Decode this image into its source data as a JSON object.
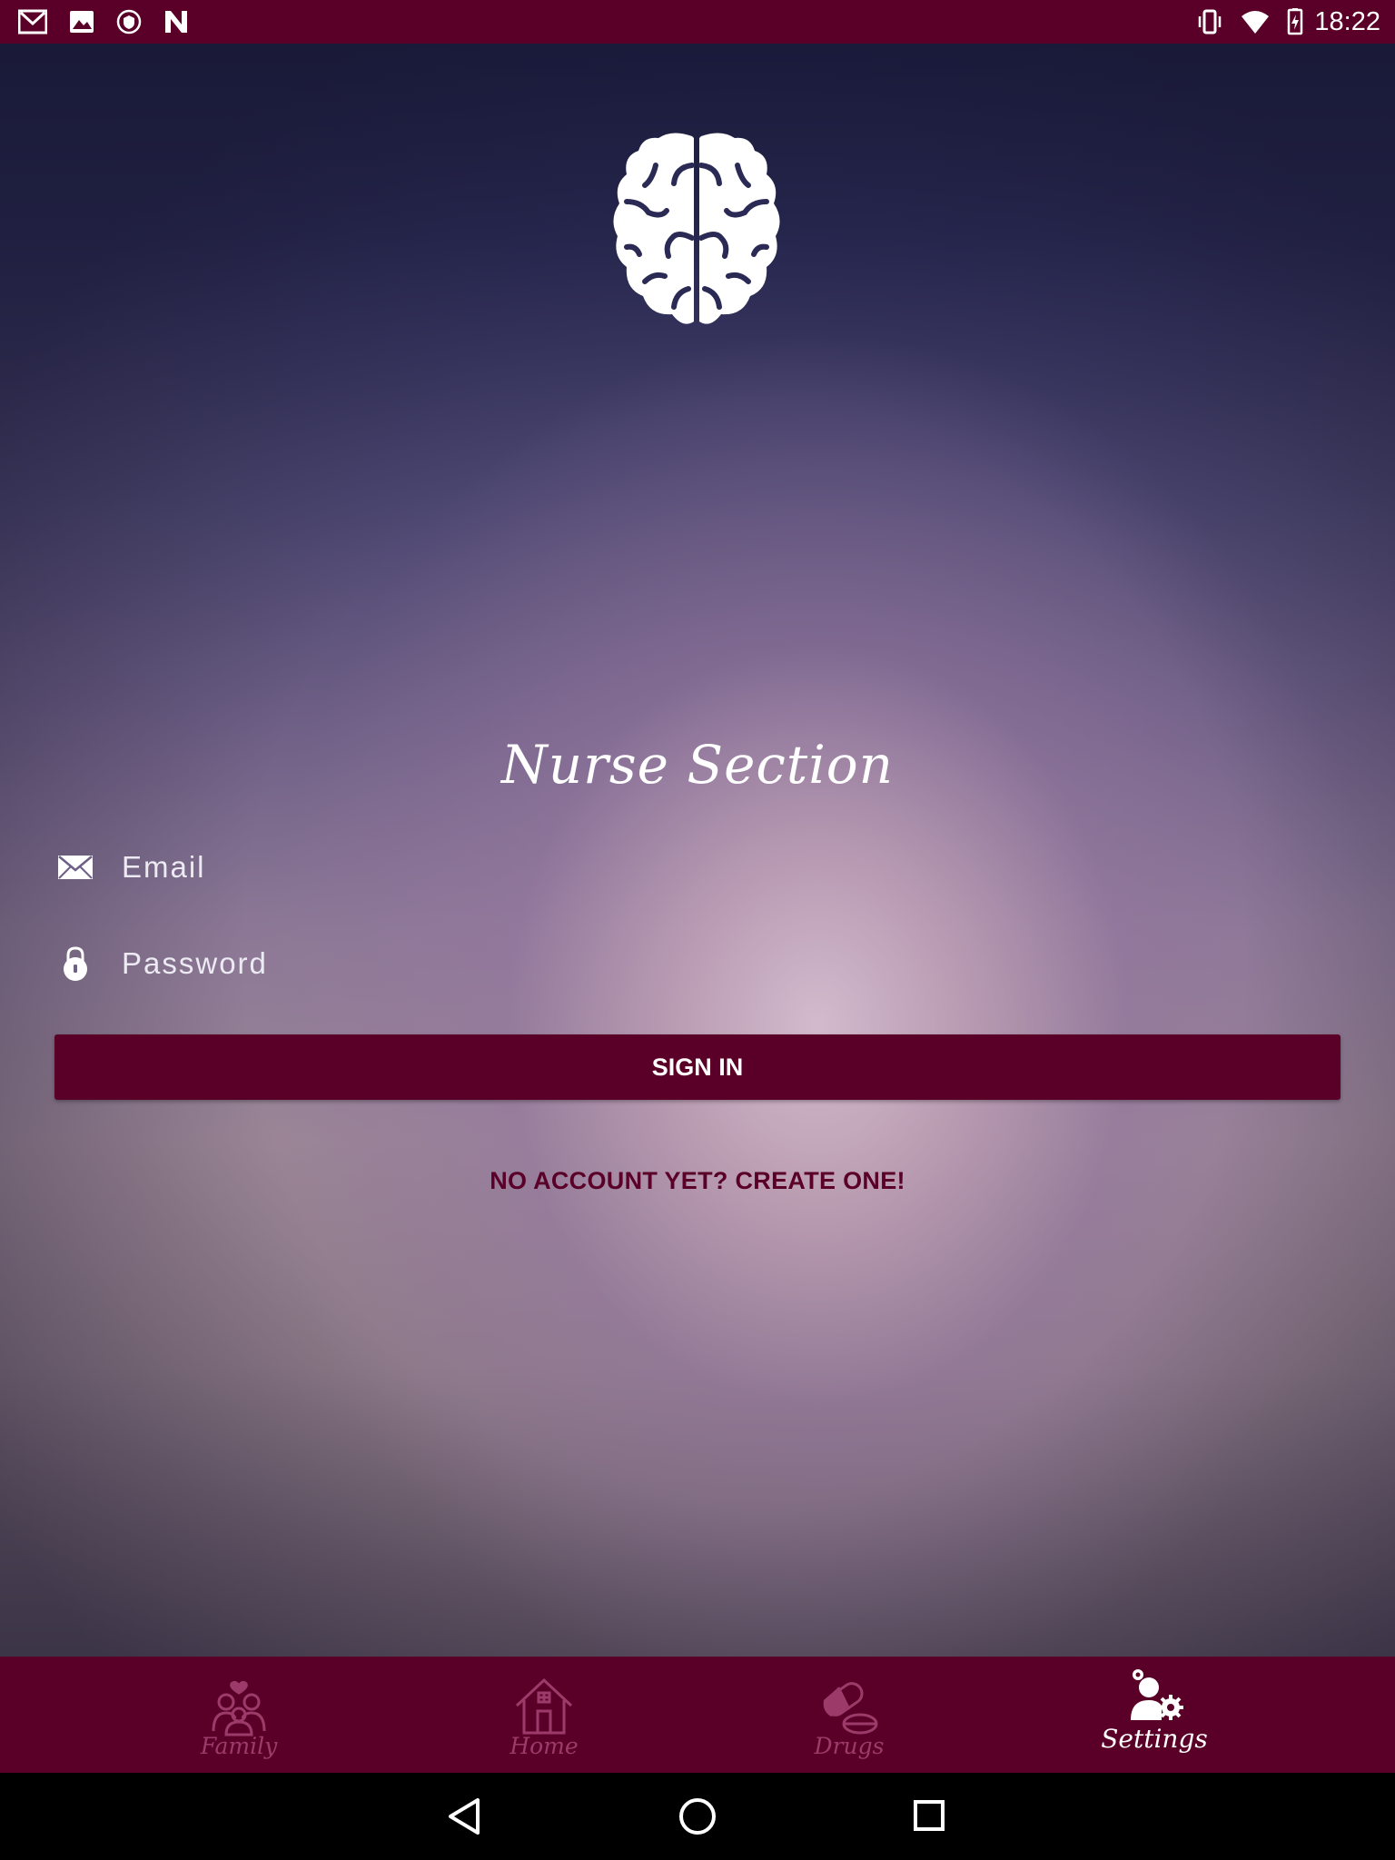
{
  "status_bar": {
    "time": "18:22",
    "left_icons": [
      "gmail-icon",
      "image-icon",
      "shield-icon",
      "n-logo-icon"
    ],
    "right_icons": [
      "vibrate-icon",
      "wifi-icon",
      "battery-icon"
    ]
  },
  "login": {
    "logo": "brain-icon",
    "title": "Nurse Section",
    "email_placeholder": "Email",
    "password_placeholder": "Password",
    "signin_label": "SIGN IN",
    "create_account_label": "NO ACCOUNT YET? CREATE ONE!"
  },
  "bottom_nav": {
    "items": [
      {
        "label": "Family",
        "icon": "family-icon",
        "active": false
      },
      {
        "label": "Home",
        "icon": "home-icon",
        "active": false
      },
      {
        "label": "Drugs",
        "icon": "pill-icon",
        "active": false
      },
      {
        "label": "Settings",
        "icon": "settings-person-icon",
        "active": true
      }
    ]
  },
  "system_nav": [
    "back-icon",
    "home-circle-icon",
    "recents-icon"
  ],
  "colors": {
    "brand": "#5a0028",
    "inactive_nav": "#9c3b6a"
  }
}
